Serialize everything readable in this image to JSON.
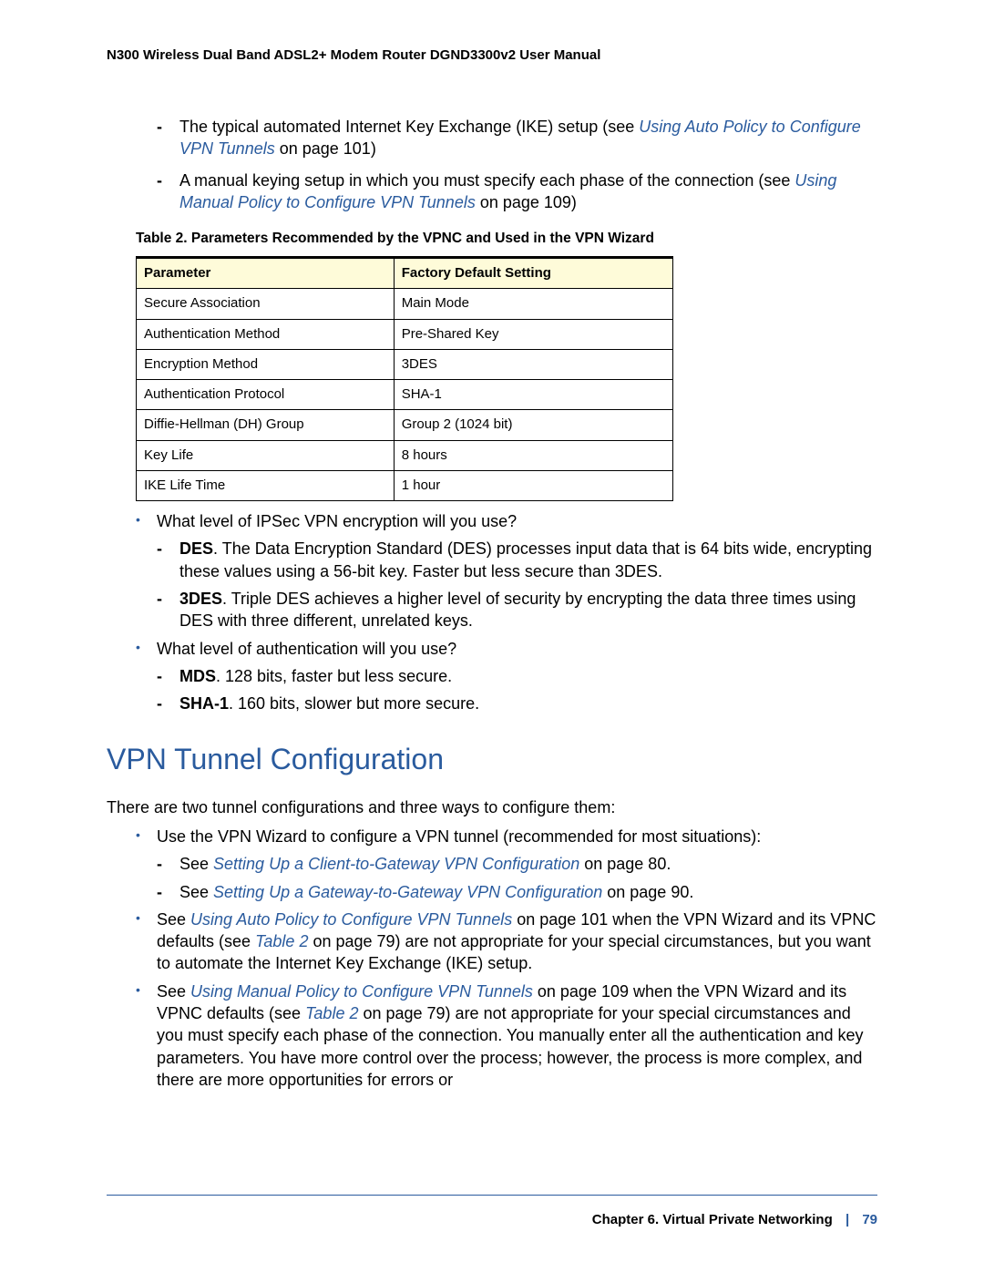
{
  "header": "N300 Wireless Dual Band ADSL2+ Modem Router DGND3300v2 User Manual",
  "intro_items": [
    {
      "pre": "The typical automated Internet Key Exchange (IKE) setup (see ",
      "link": "Using Auto Policy to Configure VPN Tunnels",
      "post": " on page 101)"
    },
    {
      "pre": "A manual keying setup in which you must specify each phase of the connection (see ",
      "link": "Using Manual Policy to Configure VPN Tunnels",
      "post": " on page 109)"
    }
  ],
  "table": {
    "caption": "Table 2.  Parameters Recommended by the VPNC and Used in the VPN Wizard",
    "headers": {
      "col1": "Parameter",
      "col2": "Factory Default Setting"
    },
    "rows": [
      {
        "p": "Secure Association",
        "v": "Main Mode"
      },
      {
        "p": "Authentication Method",
        "v": "Pre-Shared Key"
      },
      {
        "p": "Encryption Method",
        "v": "3DES"
      },
      {
        "p": "Authentication Protocol",
        "v": "SHA-1"
      },
      {
        "p": "Diffie-Hellman (DH) Group",
        "v": "Group 2 (1024 bit)"
      },
      {
        "p": "Key Life",
        "v": "8 hours"
      },
      {
        "p": "IKE Life Time",
        "v": "1 hour"
      }
    ]
  },
  "qa": {
    "q1": "What level of IPSec VPN encryption will you use?",
    "q1_items": [
      {
        "label": "DES",
        "text": ". The Data Encryption Standard (DES) processes input data that is 64 bits wide, encrypting these values using a 56-bit key. Faster but less secure than 3DES."
      },
      {
        "label": "3DES",
        "text": ". Triple DES achieves a higher level of security by encrypting the data three times using DES with three different, unrelated keys."
      }
    ],
    "q2": "What level of authentication will you use?",
    "q2_items": [
      {
        "label": "MDS",
        "text": ". 128 bits, faster but less secure."
      },
      {
        "label": "SHA-1",
        "text": ". 160 bits, slower but more secure."
      }
    ]
  },
  "section_title": "VPN Tunnel Configuration",
  "section_intro": "There are two tunnel configurations and three ways to configure them:",
  "config": {
    "item1": "Use the VPN Wizard to configure a VPN tunnel (recommended for most situations):",
    "item1_sub": [
      {
        "pre": "See ",
        "link": "Setting Up a Client-to-Gateway VPN Configuration",
        "post": " on page 80."
      },
      {
        "pre": "See ",
        "link": "Setting Up a Gateway-to-Gateway VPN Configuration",
        "post": " on page 90."
      }
    ],
    "item2": {
      "pre": "See ",
      "link1": "Using Auto Policy to Configure VPN Tunnels",
      "mid": " on page 101 when the VPN Wizard and its VPNC defaults (see ",
      "link2": "Table 2",
      "post": " on page 79) are not appropriate for your special circumstances, but you want to automate the Internet Key Exchange (IKE) setup."
    },
    "item3": {
      "pre": "See ",
      "link1": "Using Manual Policy to Configure VPN Tunnels",
      "mid": " on page 109 when the VPN Wizard and its VPNC defaults (see ",
      "link2": "Table 2",
      "post": " on page 79) are not appropriate for your special circumstances and you must specify each phase of the connection. You manually enter all the authentication and key parameters. You have more control over the process; however, the process is more complex, and there are more opportunities for errors or "
    }
  },
  "footer": {
    "chapter": "Chapter 6.  Virtual Private Networking",
    "page": "79"
  }
}
